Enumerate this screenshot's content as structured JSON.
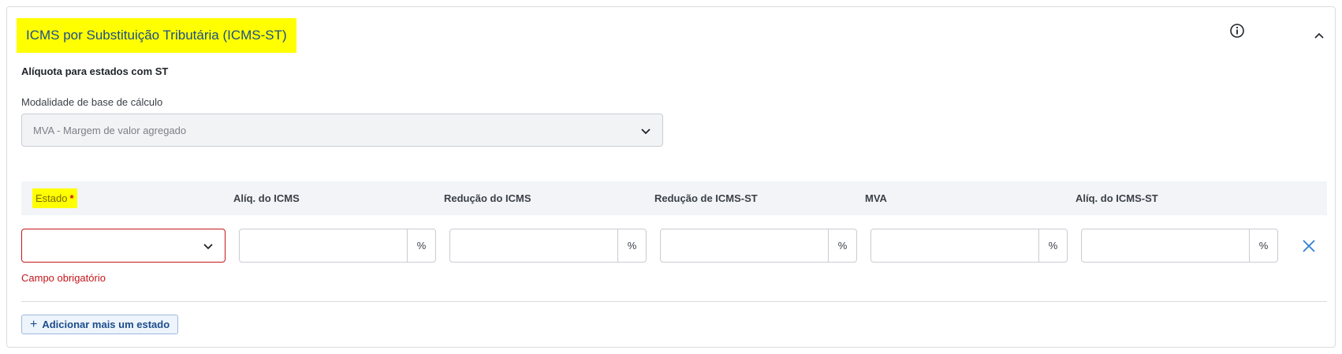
{
  "section": {
    "title": "ICMS por Substituição Tributária (ICMS-ST)",
    "info_icon": "info-circle-icon",
    "collapse_icon": "chevron-up-icon",
    "subtitle": "Alíquota para estados com ST"
  },
  "modalidade": {
    "label": "Modalidade de base de cálculo",
    "selected": "MVA - Margem de valor agregado"
  },
  "table": {
    "headers": {
      "estado": "Estado",
      "required_mark": "*",
      "aliq_icms": "Alíq. do ICMS",
      "reducao_icms": "Redução do ICMS",
      "reducao_icms_st": "Redução de ICMS-ST",
      "mva": "MVA",
      "aliq_icms_st": "Alíq. do ICMS-ST"
    },
    "row": {
      "estado_value": "",
      "aliq_icms": "",
      "reducao_icms": "",
      "reducao_icms_st": "",
      "mva": "",
      "aliq_icms_st": "",
      "suffix": "%",
      "error_text": "Campo obrigatório"
    }
  },
  "actions": {
    "add_button_label": "Adicionar mais um estado",
    "add_button_plus": "+"
  },
  "colors": {
    "accent": "#1c4d8c",
    "highlight": "#ffff00",
    "error": "#c4161c"
  }
}
